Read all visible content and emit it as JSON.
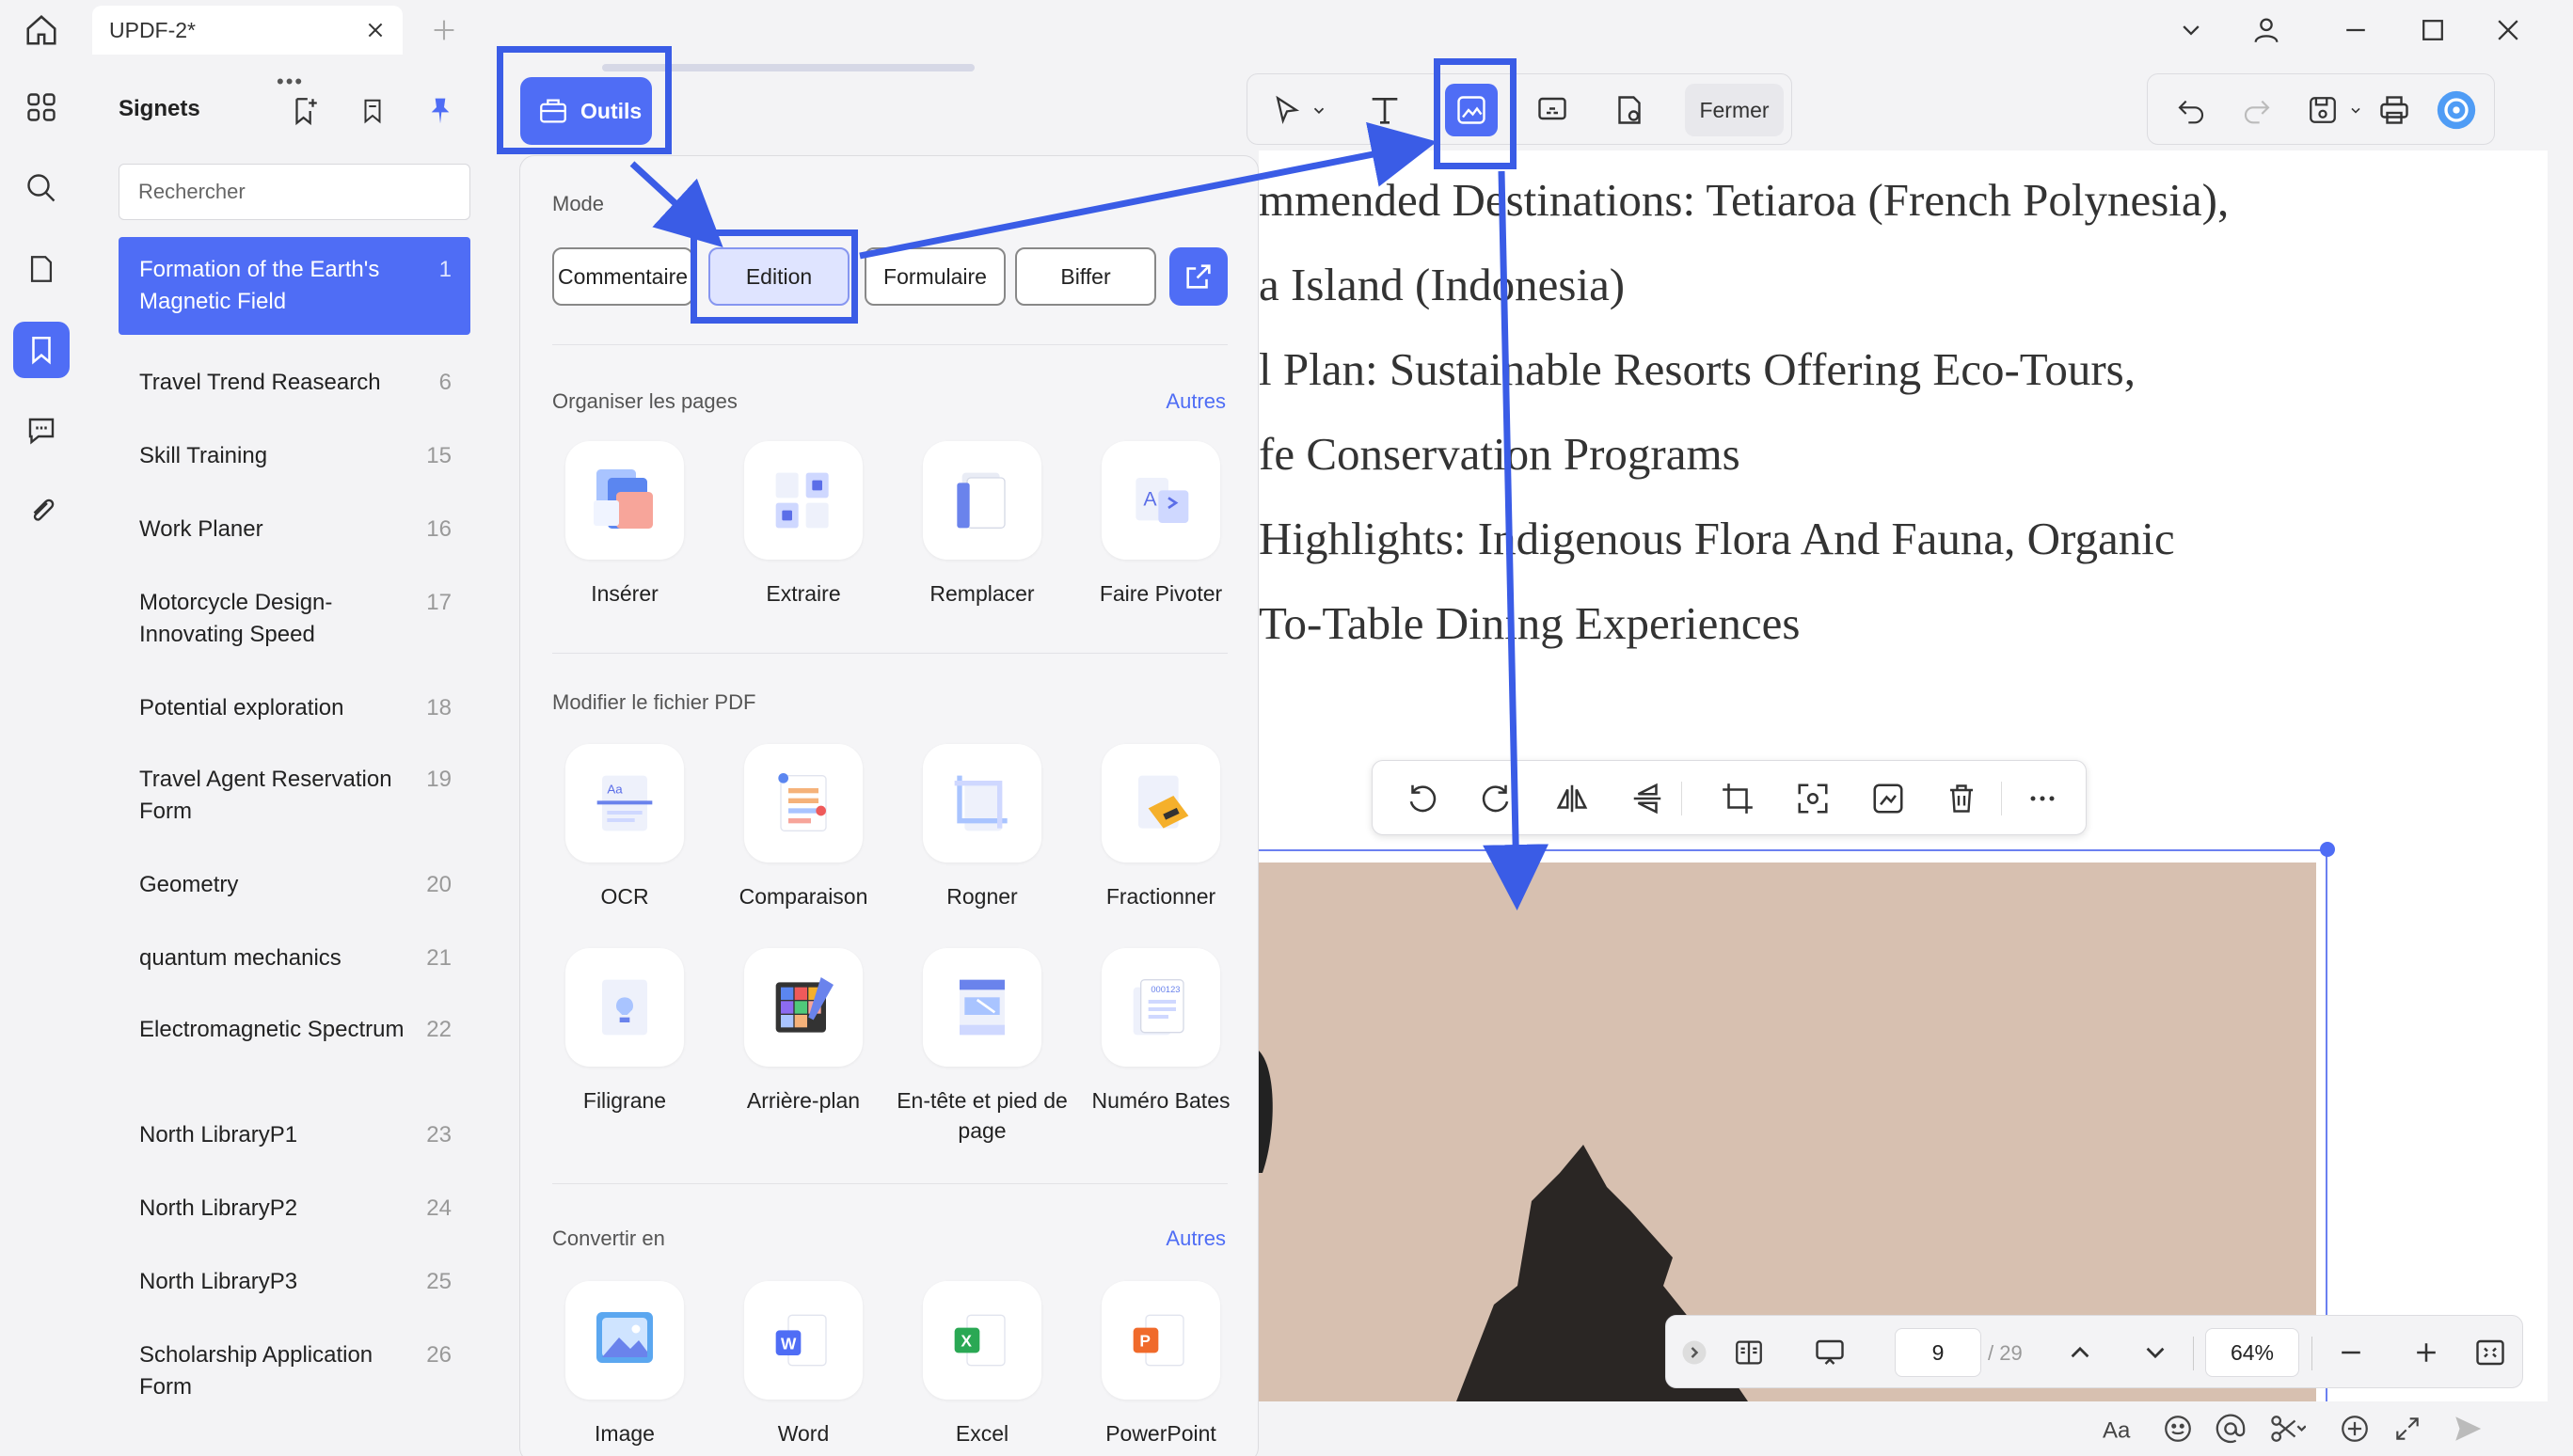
{
  "titlebar": {
    "tab_title": "UPDF-2*"
  },
  "sidebar": {
    "title": "Signets",
    "search_placeholder": "Rechercher",
    "items": [
      {
        "label": "Formation of the Earth's Magnetic Field",
        "page": "1"
      },
      {
        "label": "Travel Trend Reasearch",
        "page": "6"
      },
      {
        "label": "Skill Training",
        "page": "15"
      },
      {
        "label": "Work Planer",
        "page": "16"
      },
      {
        "label": "Motorcycle Design-Innovating Speed",
        "page": "17"
      },
      {
        "label": "Potential exploration",
        "page": "18"
      },
      {
        "label": "Travel Agent Reservation Form",
        "page": "19"
      },
      {
        "label": "Geometry",
        "page": "20"
      },
      {
        "label": "quantum mechanics",
        "page": "21"
      },
      {
        "label": "Electromagnetic Spectrum",
        "page": "22"
      },
      {
        "label": "North LibraryP1",
        "page": "23"
      },
      {
        "label": "North LibraryP2",
        "page": "24"
      },
      {
        "label": "North LibraryP3",
        "page": "25"
      },
      {
        "label": "Scholarship Application Form",
        "page": "26"
      }
    ]
  },
  "outils": {
    "label": "Outils"
  },
  "tools_menu": {
    "mode_label": "Mode",
    "modes": [
      "Commentaire",
      "Edition",
      "Formulaire",
      "Biffer"
    ],
    "organize": {
      "label": "Organiser les pages",
      "more": "Autres",
      "items": [
        "Insérer",
        "Extraire",
        "Remplacer",
        "Faire Pivoter"
      ]
    },
    "modify": {
      "label": "Modifier le fichier PDF",
      "items": [
        "OCR",
        "Comparaison",
        "Rogner",
        "Fractionner",
        "Filigrane",
        "Arrière-plan",
        "En-tête et pied de page",
        "Numéro Bates"
      ]
    },
    "convert": {
      "label": "Convertir en",
      "more": "Autres",
      "items": [
        "Image",
        "Word",
        "Excel",
        "PowerPoint"
      ]
    }
  },
  "edit_toolbar": {
    "close_label": "Fermer"
  },
  "document": {
    "lines": [
      "mmended Destinations: Tetiaroa (French Polynesia),",
      "a Island (Indonesia)",
      "l Plan: Sustainable Resorts Offering Eco-Tours,",
      "fe Conservation Programs",
      "Highlights: Indigenous Flora And Fauna, Organic",
      "To-Table Dining Experiences"
    ]
  },
  "page_nav": {
    "current": "9",
    "total": "/ 29",
    "zoom": "64%"
  },
  "colors": {
    "accent": "#4f6df5",
    "highlight": "#3a5ce6"
  }
}
